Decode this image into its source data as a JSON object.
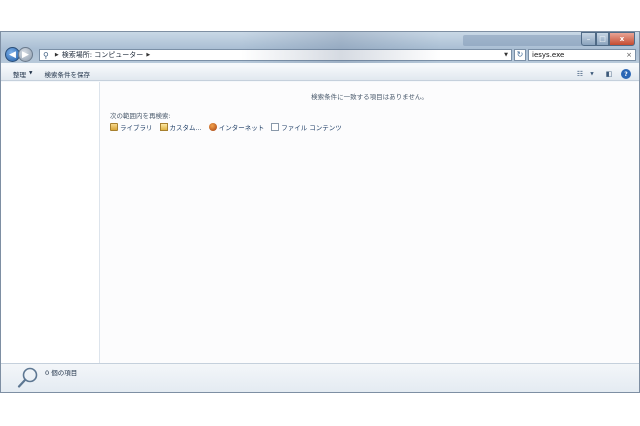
{
  "window": {
    "address": {
      "segments": [
        "検索場所: コンピューター"
      ]
    },
    "search_value": "iesys.exe",
    "caption": {
      "minimize": "–",
      "maximize": "□",
      "close": "x"
    }
  },
  "toolbar": {
    "organize_label": "整理",
    "save_search_label": "検索条件を保存"
  },
  "content": {
    "no_results": "検索条件に一致する項目はありません。",
    "search_again_label": "次の範囲内を再検索:",
    "search_again_items": [
      {
        "label": "ライブラリ",
        "icon": "library-icon"
      },
      {
        "label": "カスタム...",
        "icon": "custom-folder-icon"
      },
      {
        "label": "インターネット",
        "icon": "internet-icon"
      },
      {
        "label": "ファイル コンテンツ",
        "icon": "file-contents-icon"
      }
    ]
  },
  "details": {
    "item_count": "0 個の項目"
  }
}
